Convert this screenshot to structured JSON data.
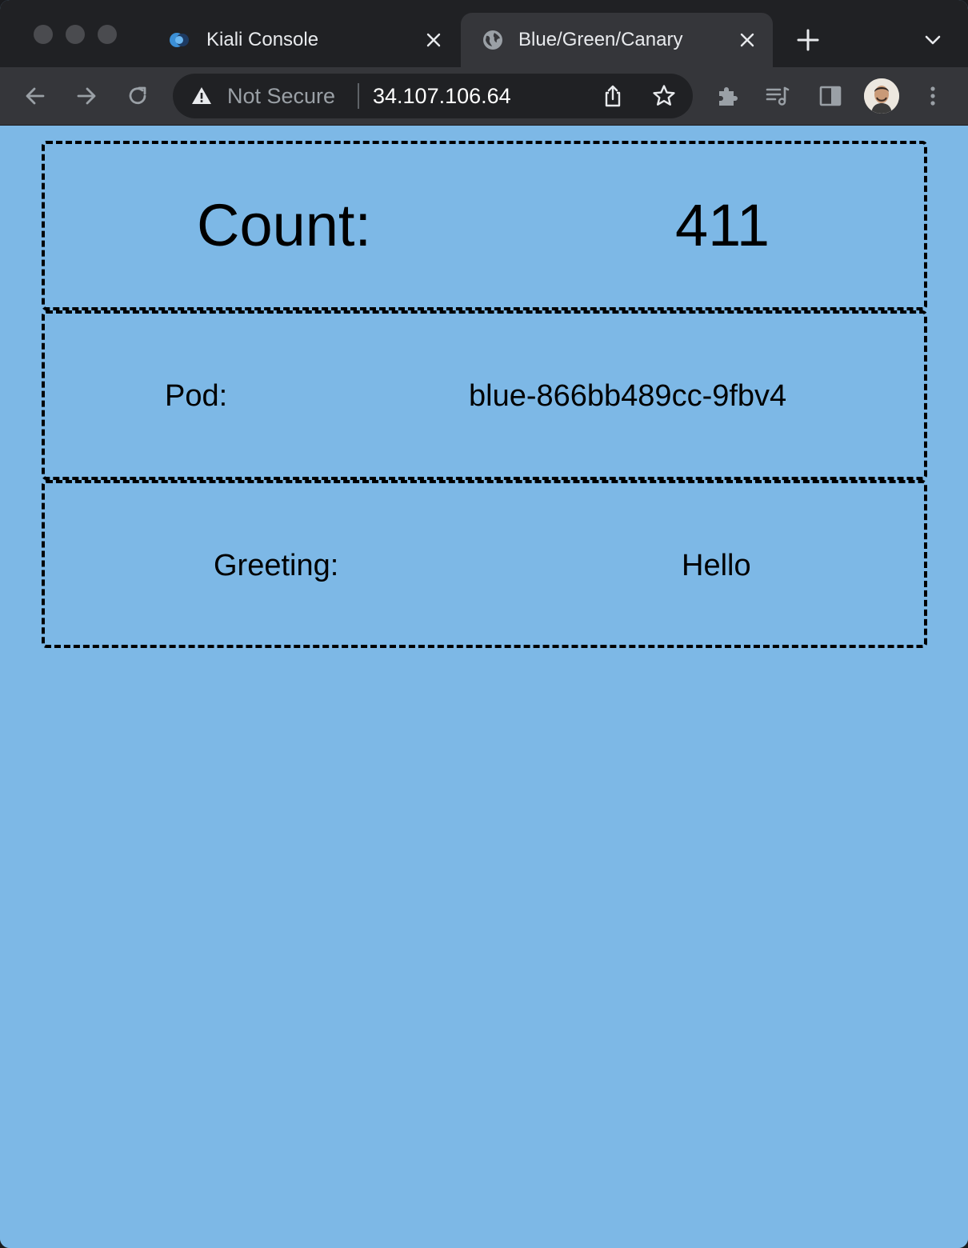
{
  "browser": {
    "tabs": [
      {
        "label": "Kiali Console",
        "icon": "kiali-logo-icon",
        "active": false
      },
      {
        "label": "Blue/Green/Canary",
        "icon": "globe-icon",
        "active": true
      }
    ],
    "address_bar": {
      "security_text": "Not Secure",
      "url": "34.107.106.64"
    }
  },
  "page": {
    "background_color": "#7db8e6",
    "rows": [
      {
        "label": "Count:",
        "value": "411"
      },
      {
        "label": "Pod:",
        "value": "blue-866bb489cc-9fbv4"
      },
      {
        "label": "Greeting:",
        "value": "Hello"
      }
    ]
  }
}
